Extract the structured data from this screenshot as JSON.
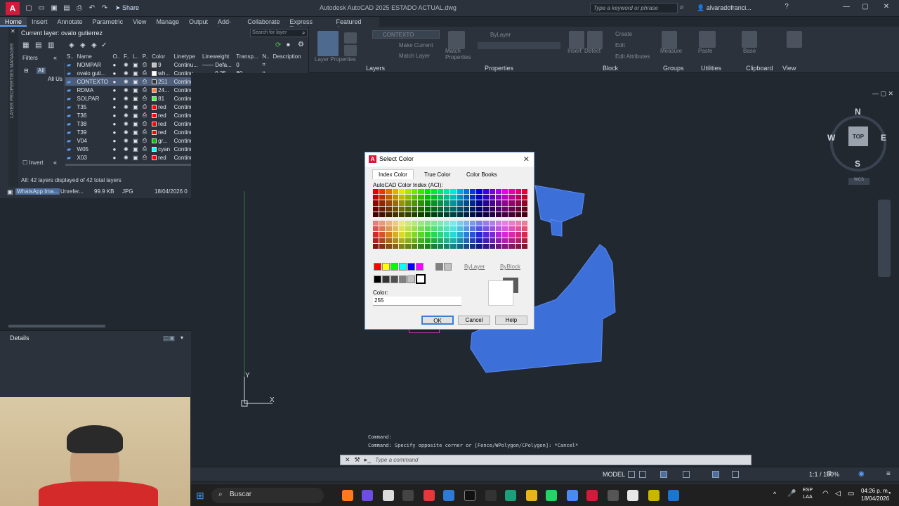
{
  "app": {
    "logo": "A",
    "title": "Autodesk AutoCAD 2025   ESTADO ACTUAL.dwg",
    "share_label": "Share",
    "search_placeholder": "Type a keyword or phrase",
    "user": "alvaradofranci..."
  },
  "ribbon": {
    "tabs": [
      "Home",
      "Insert",
      "Annotate",
      "Parametric",
      "View",
      "Manage",
      "Output",
      "Add-ins",
      "Collaborate",
      "Express Tools",
      "Featured Apps"
    ],
    "active_tab": "Home",
    "panels": [
      "Layers",
      "Properties",
      "Block",
      "Groups",
      "Utilities",
      "Clipboard",
      "View"
    ],
    "layer_dropdown": "CONTEXTO",
    "bylayer_label": "ByLayer",
    "tools": [
      "Make Current",
      "Match Layer",
      "Create",
      "Edit",
      "Edit Attributes",
      "Insert",
      "Detect",
      "Match Properties",
      "Layer Properties",
      "Group",
      "Measure",
      "Paste",
      "Base"
    ]
  },
  "layer_manager": {
    "vertical_title": "LAYER PROPERTIES MANAGER",
    "current_layer": "Current layer: ovalo gutierrez",
    "search_placeholder": "Search for layer",
    "filters_label": "Filters",
    "tree": [
      "All",
      "All Us"
    ],
    "invert_label": "Invert",
    "status": "All: 42 layers displayed of 42 total layers",
    "columns": [
      "S..",
      "Name",
      "O..",
      "F..",
      "L..",
      "P..",
      "Color",
      "Linetype",
      "Lineweight",
      "Transp...",
      "N..",
      "Description"
    ],
    "rows": [
      {
        "name": "NOMPAR",
        "color_name": "9",
        "swatch": "#c0c0c0",
        "linetype": "Continu...",
        "lineweight": "Defa...",
        "transp": "0",
        "selected": false
      },
      {
        "name": "ovalo guti...",
        "color_name": "wh...",
        "swatch": "#ffffff",
        "linetype": "Continu...",
        "lineweight": "0.25...",
        "transp": "80",
        "selected": false
      },
      {
        "name": "CONTEXTO",
        "color_name": "251",
        "swatch": "#333333",
        "linetype": "Continu...",
        "lineweight": "0.25...",
        "transp": "0",
        "selected": true
      },
      {
        "name": "RDMA",
        "color_name": "24...",
        "swatch": "#ff8040",
        "linetype": "Continu...",
        "lineweight": "Defa...",
        "transp": "0",
        "selected": false
      },
      {
        "name": "SOLPAR",
        "color_name": "81",
        "swatch": "#40ff40",
        "linetype": "Continu...",
        "lineweight": "Defa...",
        "transp": "0",
        "selected": false
      },
      {
        "name": "T35",
        "color_name": "red",
        "swatch": "#ff0000",
        "linetype": "Continu...",
        "lineweight": "Defa...",
        "transp": "0",
        "selected": false
      },
      {
        "name": "T36",
        "color_name": "red",
        "swatch": "#ff0000",
        "linetype": "Continu...",
        "lineweight": "Defa...",
        "transp": "0",
        "selected": false
      },
      {
        "name": "T38",
        "color_name": "red",
        "swatch": "#ff0000",
        "linetype": "Continu...",
        "lineweight": "Defa...",
        "transp": "0",
        "selected": false
      },
      {
        "name": "T39",
        "color_name": "red",
        "swatch": "#ff0000",
        "linetype": "Continu...",
        "lineweight": "Defa...",
        "transp": "0",
        "selected": false
      },
      {
        "name": "V04",
        "color_name": "gr...",
        "swatch": "#00c000",
        "linetype": "Continu...",
        "lineweight": "Defa...",
        "transp": "0",
        "selected": false
      },
      {
        "name": "W05",
        "color_name": "cyan",
        "swatch": "#00ffff",
        "linetype": "Continu...",
        "lineweight": "Defa...",
        "transp": "0",
        "selected": false
      },
      {
        "name": "X03",
        "color_name": "red",
        "swatch": "#ff0000",
        "linetype": "Continu...",
        "lineweight": "Defa...",
        "transp": "0",
        "selected": false
      }
    ]
  },
  "file_row": {
    "name": "WhatsApp Ima...",
    "status": "Unrefer...",
    "size": "99.9 KB",
    "type": "JPG",
    "date": "18/04/2026 0"
  },
  "details": {
    "title": "Details"
  },
  "viewcube": {
    "top": "TOP",
    "n": "N",
    "s": "S",
    "e": "E",
    "w": "W",
    "wcs": "WCS"
  },
  "ucs": {
    "x": "X",
    "y": "Y"
  },
  "dialog": {
    "title": "Select Color",
    "tabs": [
      "Index Color",
      "True Color",
      "Color Books"
    ],
    "aci_label": "AutoCAD Color Index (ACI):",
    "bylayer": "ByLayer",
    "byblock": "ByBlock",
    "color_label": "Color:",
    "color_value": "255",
    "ok": "OK",
    "cancel": "Cancel",
    "help": "Help",
    "standard_colors": [
      "#ff0000",
      "#ffff00",
      "#00ff00",
      "#00ffff",
      "#0000ff",
      "#ff00ff"
    ],
    "gray_colors": [
      "#000000",
      "#333333",
      "#505050",
      "#808080",
      "#c0c0c0",
      "#ffffff"
    ],
    "preview_old": "#5a5a5a",
    "preview_new": "#ffffff"
  },
  "command": {
    "history1": "Command:",
    "history2": "Command: Specify opposite corner or [Fence/WPolygon/CPolygon]: *Cancel*",
    "placeholder": "Type a command"
  },
  "statusbar": {
    "model": "MODEL",
    "scale": "1:1 / 100%"
  },
  "taskbar": {
    "search": "Buscar",
    "lang1": "ESP",
    "lang2": "LAA",
    "time": "04:26 p. m.",
    "date": "18/04/2026"
  }
}
